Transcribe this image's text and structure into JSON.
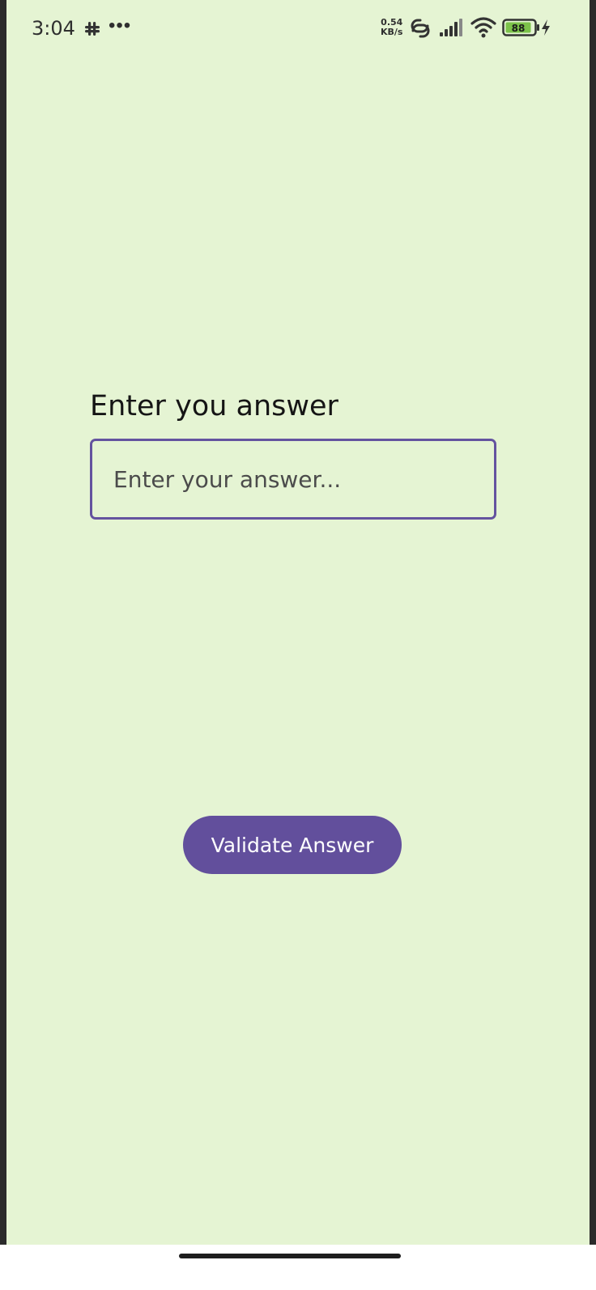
{
  "status_bar": {
    "time": "3:04",
    "overflow": "•••",
    "net_speed_value": "0.54",
    "net_speed_unit": "KB/s",
    "battery_level": "88",
    "icons": [
      "slack-icon",
      "hotspot-icon",
      "signal-icon",
      "wifi-icon",
      "battery-icon",
      "charging-icon"
    ]
  },
  "form": {
    "heading": "Enter you answer",
    "answer_placeholder": "Enter your answer...",
    "answer_value": "",
    "validate_label": "Validate Answer"
  },
  "colors": {
    "background": "#e5f4d3",
    "accent": "#624f9c",
    "field_border": "#64539f",
    "battery_fill": "#7cc24a"
  }
}
